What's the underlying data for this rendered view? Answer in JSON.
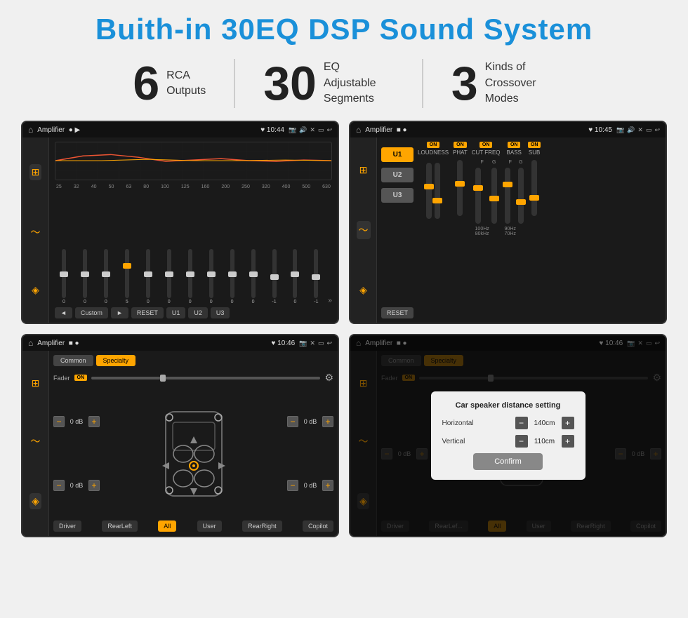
{
  "page": {
    "title": "Buith-in 30EQ DSP Sound System",
    "bg_color": "#f0f0f0"
  },
  "stats": [
    {
      "number": "6",
      "label": "RCA\nOutputs"
    },
    {
      "number": "30",
      "label": "EQ Adjustable\nSegments"
    },
    {
      "number": "3",
      "label": "Kinds of\nCrossover Modes"
    }
  ],
  "screens": [
    {
      "id": "eq-screen",
      "status_bar": {
        "title": "Amplifier",
        "time": "10:44"
      },
      "freq_labels": [
        "25",
        "32",
        "40",
        "50",
        "63",
        "80",
        "100",
        "125",
        "160",
        "200",
        "250",
        "320",
        "400",
        "500",
        "630"
      ],
      "sliders": [
        {
          "value": "0",
          "pos": 50
        },
        {
          "value": "0",
          "pos": 50
        },
        {
          "value": "0",
          "pos": 50
        },
        {
          "value": "5",
          "pos": 35
        },
        {
          "value": "0",
          "pos": 50
        },
        {
          "value": "0",
          "pos": 50
        },
        {
          "value": "0",
          "pos": 50
        },
        {
          "value": "0",
          "pos": 50
        },
        {
          "value": "0",
          "pos": 50
        },
        {
          "value": "0",
          "pos": 50
        },
        {
          "value": "-1",
          "pos": 55
        },
        {
          "value": "0",
          "pos": 50
        },
        {
          "value": "-1",
          "pos": 55
        }
      ],
      "controls": [
        "◄",
        "Custom",
        "►",
        "RESET",
        "U1",
        "U2",
        "U3"
      ]
    },
    {
      "id": "crossover-screen",
      "status_bar": {
        "title": "Amplifier",
        "time": "10:45"
      },
      "u_buttons": [
        "U1",
        "U2",
        "U3"
      ],
      "bands": [
        {
          "label": "LOUDNESS",
          "on": true
        },
        {
          "label": "PHAT",
          "on": true
        },
        {
          "label": "CUT FREQ",
          "on": true
        },
        {
          "label": "BASS",
          "on": true
        },
        {
          "label": "SUB",
          "on": true
        }
      ]
    },
    {
      "id": "speaker-fader-screen",
      "status_bar": {
        "title": "Amplifier",
        "time": "10:46"
      },
      "tabs": [
        "Common",
        "Specialty"
      ],
      "active_tab": "Specialty",
      "fader_label": "Fader",
      "fader_on": "ON",
      "db_controls": [
        {
          "value": "0 dB"
        },
        {
          "value": "0 dB"
        },
        {
          "value": "0 dB"
        },
        {
          "value": "0 dB"
        }
      ],
      "buttons": [
        "Driver",
        "All",
        "RearLeft",
        "User",
        "RearRight",
        "Copilot"
      ]
    },
    {
      "id": "dialog-screen",
      "status_bar": {
        "title": "Amplifier",
        "time": "10:46"
      },
      "dialog": {
        "title": "Car speaker distance setting",
        "horizontal_label": "Horizontal",
        "horizontal_value": "140cm",
        "vertical_label": "Vertical",
        "vertical_value": "110cm",
        "confirm_label": "Confirm"
      },
      "tabs": [
        "Common",
        "Specialty"
      ],
      "buttons": [
        "Driver",
        "All",
        "RearLeft",
        "User",
        "RearRight",
        "Copilot"
      ],
      "db_controls": [
        {
          "value": "0 dB"
        },
        {
          "value": "0 dB"
        }
      ]
    }
  ]
}
